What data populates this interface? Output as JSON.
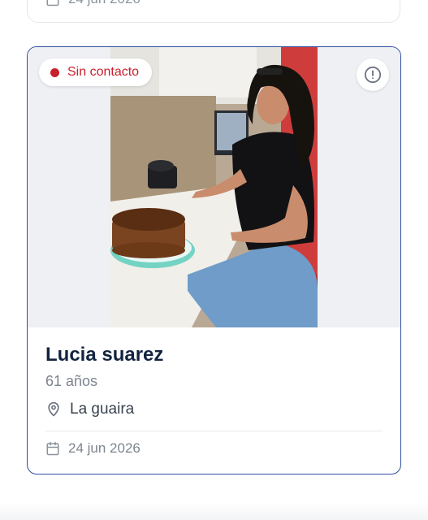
{
  "previous_card": {
    "date": "24 jun 2026"
  },
  "card": {
    "status": {
      "label": "Sin contacto",
      "color": "#c8202d"
    },
    "alert_icon": "alert-circle-icon",
    "name": "Lucia suarez",
    "age": "61 años",
    "location": "La guaira",
    "date": "24 jun 2026",
    "border_color": "#2f4fa3"
  }
}
